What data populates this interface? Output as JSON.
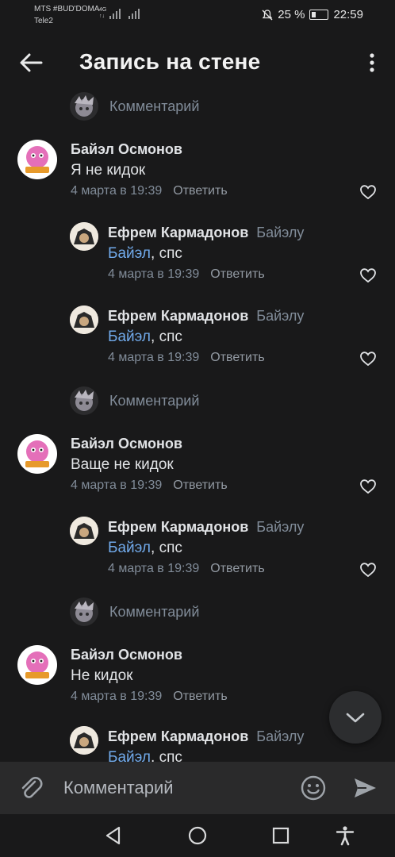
{
  "status_bar": {
    "carrier_1": "MTS #BUD'DOMA",
    "carrier_2": "Tele2",
    "network_top": "4G",
    "network_bottom": "↑↓",
    "battery_percent": "25 %",
    "time": "22:59"
  },
  "header": {
    "title": "Запись на стене"
  },
  "composer": {
    "placeholder": "Комментарий"
  },
  "thread": {
    "stub_label": "Комментарий",
    "reply_label": "Ответить",
    "reply_to_label": "Байэлу",
    "mention_label": "Байэл",
    "mention_suffix": ", спс"
  },
  "comments": [
    {
      "author": "Байэл Осмонов",
      "text": "Я не кидок",
      "date": "4 марта в 19:39"
    },
    {
      "author": "Ефрем Кармадонов",
      "date": "4 марта в 19:39"
    },
    {
      "author": "Ефрем Кармадонов",
      "date": "4 марта в 19:39"
    },
    {
      "author": "Байэл Осмонов",
      "text": "Ваще не кидок",
      "date": "4 марта в 19:39"
    },
    {
      "author": "Ефрем Кармадонов",
      "date": "4 марта в 19:39"
    },
    {
      "author": "Байэл Осмонов",
      "text": "Не кидок",
      "date": "4 марта в 19:39"
    },
    {
      "author": "Ефрем Кармадонов"
    }
  ],
  "colors": {
    "background": "#19191a",
    "mention": "#71aaeb",
    "secondary_text": "#818c99"
  }
}
